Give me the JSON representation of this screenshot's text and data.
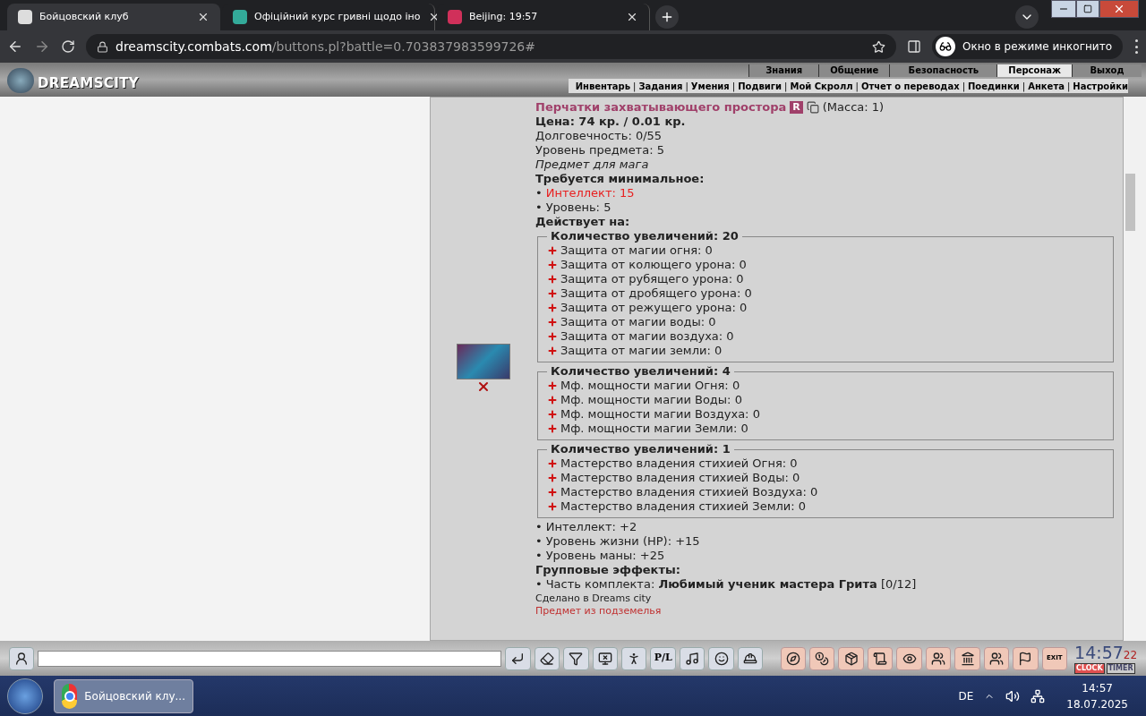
{
  "browser": {
    "tabs": [
      {
        "title": "Бойцовский клуб",
        "selected": true
      },
      {
        "title": "Офіційний курс гривні щодо іно",
        "selected": false
      },
      {
        "title": "Beijing: 19:57",
        "selected": false
      }
    ],
    "url_host": "dreamscity.combats.com",
    "url_path": "/buttons.pl?battle=0.703837983599726#",
    "incognito_label": "Окно в режиме инкогнито"
  },
  "game_header": {
    "logo": "DREAMSCITY",
    "top_menu": [
      {
        "label": "Знания",
        "selected": false
      },
      {
        "label": "Общение",
        "selected": false
      },
      {
        "label": "Безопасность",
        "selected": false
      },
      {
        "label": "Персонаж",
        "selected": true
      },
      {
        "label": "Выход",
        "selected": false
      }
    ],
    "separator": "|",
    "sub_menu": [
      "Инвентарь",
      "Задания",
      "Умения",
      "Подвиги",
      "Мой Скролл",
      "Отчет о переводах",
      "Поединки",
      "Анкета",
      "Настройки"
    ]
  },
  "item": {
    "name": "Перчатки захватывающего простора",
    "rarity_badge": "R",
    "mass": "(Масса: 1)",
    "price": "Цена: 74 кр. / 0.01 кр.",
    "plain_lines": [
      "Долговечность: 0/55",
      "Уровень предмета: 5"
    ],
    "note": "Предмет для мага",
    "requirements_title": "Требуется минимальное:",
    "requirements": [
      {
        "bullet": "•",
        "text": "Интеллект: 15",
        "met": false
      },
      {
        "bullet": "•",
        "text": "Уровень: 5",
        "met": true
      }
    ],
    "effects_title": "Действует на:",
    "groups": [
      {
        "legend": "Количество увеличений: 20",
        "items": [
          "Защита от магии огня: 0",
          "Защита от колющего урона: 0",
          "Защита от рубящего урона: 0",
          "Защита от дробящего урона: 0",
          "Защита от режущего урона: 0",
          "Защита от магии воды: 0",
          "Защита от магии воздуха: 0",
          "Защита от магии земли: 0"
        ]
      },
      {
        "legend": "Количество увеличений: 4",
        "items": [
          "Мф. мощности магии Огня: 0",
          "Мф. мощности магии Воды: 0",
          "Мф. мощности магии Воздуха: 0",
          "Мф. мощности магии Земли: 0"
        ]
      },
      {
        "legend": "Количество увеличений: 1",
        "items": [
          "Мастерство владения стихией Огня: 0",
          "Мастерство владения стихией Воды: 0",
          "Мастерство владения стихией Воздуха: 0",
          "Мастерство владения стихией Земли: 0"
        ]
      }
    ],
    "bonuses": [
      {
        "bullet": "•",
        "text": "Интеллект: +2"
      },
      {
        "bullet": "•",
        "text": "Уровень жизни (HP): +15"
      },
      {
        "bullet": "•",
        "text": "Уровень маны: +25"
      }
    ],
    "group_effects_title": "Групповые эффекты:",
    "set_line": {
      "bullet": "•",
      "text": "Часть комплекта: **Любимый ученик мастера Грита** [0/12]"
    },
    "made_in": "Сделано в Dreams city",
    "origin": "Предмет из подземелья"
  },
  "bottom_bar": {
    "pl_label": "P/L",
    "exit_label": "EXIT",
    "clock": "14:57",
    "seconds": "22",
    "clock_tab": "CLOCK",
    "timer_tab": "TIMER"
  },
  "taskbar": {
    "app": "Бойцовский клу...",
    "language": "DE",
    "time": "14:57",
    "date": "18.07.2025"
  }
}
